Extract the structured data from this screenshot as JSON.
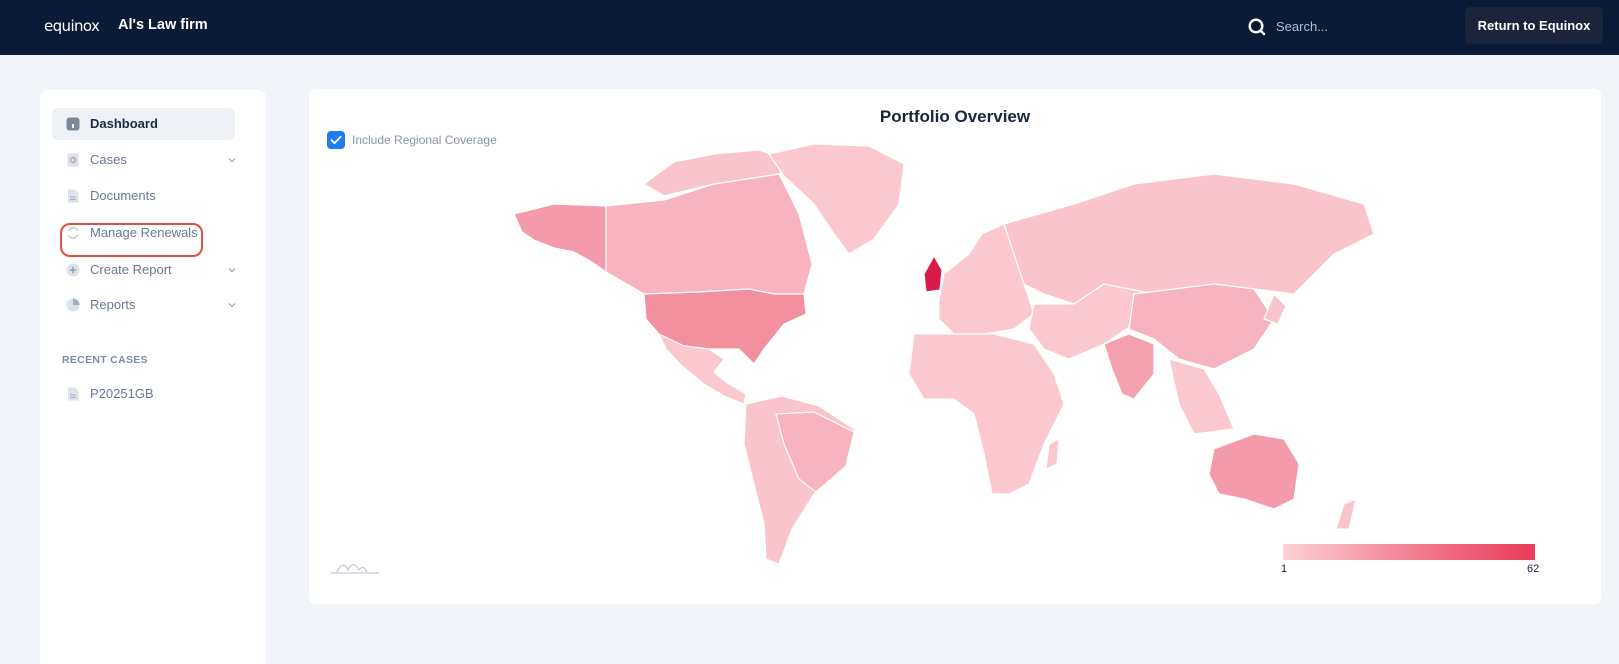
{
  "header": {
    "brand": "equinox",
    "firm_name": "Al's Law firm",
    "search_placeholder": "Search...",
    "return_button": "Return to Equinox"
  },
  "sidebar": {
    "items": [
      {
        "label": "Dashboard",
        "icon": "dashboard-icon",
        "active": true
      },
      {
        "label": "Cases",
        "icon": "cases-icon",
        "expandable": true
      },
      {
        "label": "Documents",
        "icon": "document-icon"
      },
      {
        "label": "Manage Renewals",
        "icon": "renew-icon",
        "highlighted": true
      },
      {
        "label": "Create Report",
        "icon": "plus-icon",
        "expandable": true
      },
      {
        "label": "Reports",
        "icon": "pie-icon",
        "expandable": true
      }
    ],
    "recent_title": "RECENT CASES",
    "recent_cases": [
      {
        "label": "P20251GB",
        "icon": "document-icon"
      }
    ]
  },
  "main": {
    "title": "Portfolio Overview",
    "checkbox_label": "Include Regional Coverage",
    "checkbox_checked": true,
    "legend": {
      "min": "1",
      "max": "62",
      "color_low": "#fbd2d7",
      "color_high": "#ea3a59"
    }
  },
  "colors": {
    "topbar": "#0b1a36",
    "accent": "#1f7cf2",
    "highlight": "#e0503e"
  }
}
